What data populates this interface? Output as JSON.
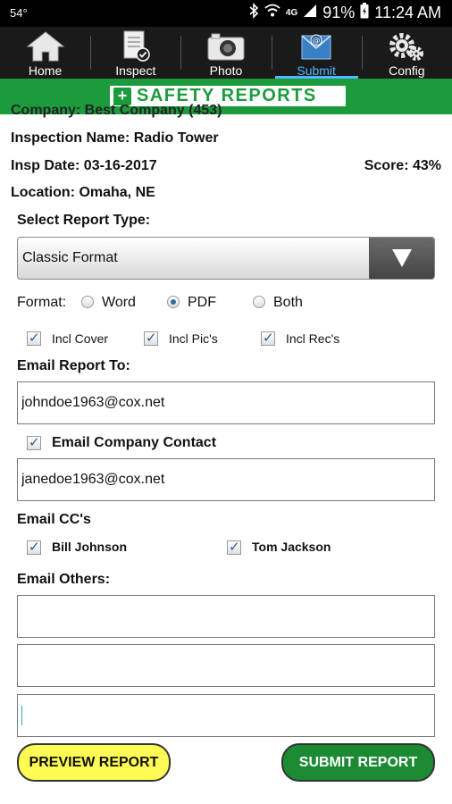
{
  "status_bar": {
    "temperature": "54°",
    "battery": "91%",
    "time": "11:24 AM",
    "network": "4G",
    "icons": [
      "bluetooth-icon",
      "wifi-icon",
      "lte-icon",
      "signal-icon",
      "battery-icon"
    ]
  },
  "nav": {
    "items": [
      {
        "label": "Home",
        "icon": "home-icon"
      },
      {
        "label": "Inspect",
        "icon": "inspect-clipboard-icon"
      },
      {
        "label": "Photo",
        "icon": "camera-icon"
      },
      {
        "label": "Submit",
        "icon": "email-submit-icon",
        "active": true
      },
      {
        "label": "Config",
        "icon": "gears-icon"
      }
    ]
  },
  "banner": {
    "logo_text": "SAFETY REPORTS",
    "brand_color": "#1c9b3d"
  },
  "info": {
    "company_clipped": "Company: Best Company (453)",
    "inspection_name": "Inspection Name: Radio Tower",
    "insp_date": "Insp Date: 03-16-2017",
    "score": "Score: 43%",
    "location": "Location: Omaha, NE"
  },
  "report": {
    "type_label": "Select Report Type:",
    "type_value": "Classic Format",
    "format_label": "Format:",
    "formats": [
      {
        "label": "Word",
        "selected": false
      },
      {
        "label": "PDF",
        "selected": true
      },
      {
        "label": "Both",
        "selected": false
      }
    ],
    "includes": [
      {
        "label": "Incl Cover",
        "checked": true
      },
      {
        "label": "Incl Pic's",
        "checked": true
      },
      {
        "label": "Incl Rec's",
        "checked": true
      }
    ]
  },
  "email": {
    "to_label": "Email Report To:",
    "to_value": "johndoe1963@cox.net",
    "company_contact_label": "Email Company Contact",
    "company_contact_checked": true,
    "company_contact_value": "janedoe1963@cox.net",
    "cc_label": "Email CC's",
    "cc": [
      {
        "name": "Bill Johnson",
        "checked": true
      },
      {
        "name": "Tom Jackson",
        "checked": true
      }
    ],
    "others_label": "Email Others:",
    "others": [
      "",
      "",
      ""
    ]
  },
  "buttons": {
    "preview": "PREVIEW REPORT",
    "submit": "SUBMIT REPORT",
    "preview_color": "#fffb55",
    "submit_color": "#1c8a33"
  }
}
